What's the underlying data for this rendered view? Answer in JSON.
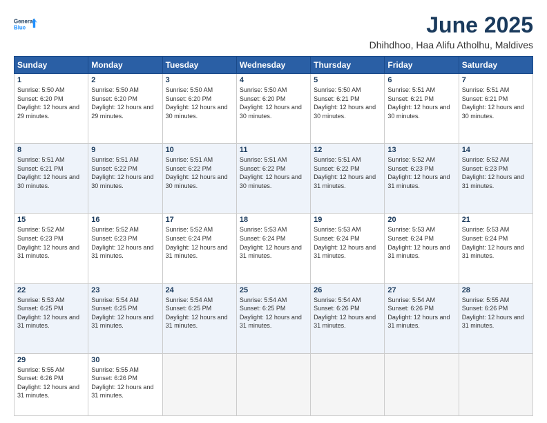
{
  "logo": {
    "line1": "General",
    "line2": "Blue"
  },
  "title": "June 2025",
  "location": "Dhihdhoo, Haa Alifu Atholhu, Maldives",
  "days_of_week": [
    "Sunday",
    "Monday",
    "Tuesday",
    "Wednesday",
    "Thursday",
    "Friday",
    "Saturday"
  ],
  "weeks": [
    [
      {
        "day": "1",
        "sunrise": "5:50 AM",
        "sunset": "6:20 PM",
        "daylight": "12 hours and 29 minutes."
      },
      {
        "day": "2",
        "sunrise": "5:50 AM",
        "sunset": "6:20 PM",
        "daylight": "12 hours and 29 minutes."
      },
      {
        "day": "3",
        "sunrise": "5:50 AM",
        "sunset": "6:20 PM",
        "daylight": "12 hours and 30 minutes."
      },
      {
        "day": "4",
        "sunrise": "5:50 AM",
        "sunset": "6:20 PM",
        "daylight": "12 hours and 30 minutes."
      },
      {
        "day": "5",
        "sunrise": "5:50 AM",
        "sunset": "6:21 PM",
        "daylight": "12 hours and 30 minutes."
      },
      {
        "day": "6",
        "sunrise": "5:51 AM",
        "sunset": "6:21 PM",
        "daylight": "12 hours and 30 minutes."
      },
      {
        "day": "7",
        "sunrise": "5:51 AM",
        "sunset": "6:21 PM",
        "daylight": "12 hours and 30 minutes."
      }
    ],
    [
      {
        "day": "8",
        "sunrise": "5:51 AM",
        "sunset": "6:21 PM",
        "daylight": "12 hours and 30 minutes."
      },
      {
        "day": "9",
        "sunrise": "5:51 AM",
        "sunset": "6:22 PM",
        "daylight": "12 hours and 30 minutes."
      },
      {
        "day": "10",
        "sunrise": "5:51 AM",
        "sunset": "6:22 PM",
        "daylight": "12 hours and 30 minutes."
      },
      {
        "day": "11",
        "sunrise": "5:51 AM",
        "sunset": "6:22 PM",
        "daylight": "12 hours and 30 minutes."
      },
      {
        "day": "12",
        "sunrise": "5:51 AM",
        "sunset": "6:22 PM",
        "daylight": "12 hours and 31 minutes."
      },
      {
        "day": "13",
        "sunrise": "5:52 AM",
        "sunset": "6:23 PM",
        "daylight": "12 hours and 31 minutes."
      },
      {
        "day": "14",
        "sunrise": "5:52 AM",
        "sunset": "6:23 PM",
        "daylight": "12 hours and 31 minutes."
      }
    ],
    [
      {
        "day": "15",
        "sunrise": "5:52 AM",
        "sunset": "6:23 PM",
        "daylight": "12 hours and 31 minutes."
      },
      {
        "day": "16",
        "sunrise": "5:52 AM",
        "sunset": "6:23 PM",
        "daylight": "12 hours and 31 minutes."
      },
      {
        "day": "17",
        "sunrise": "5:52 AM",
        "sunset": "6:24 PM",
        "daylight": "12 hours and 31 minutes."
      },
      {
        "day": "18",
        "sunrise": "5:53 AM",
        "sunset": "6:24 PM",
        "daylight": "12 hours and 31 minutes."
      },
      {
        "day": "19",
        "sunrise": "5:53 AM",
        "sunset": "6:24 PM",
        "daylight": "12 hours and 31 minutes."
      },
      {
        "day": "20",
        "sunrise": "5:53 AM",
        "sunset": "6:24 PM",
        "daylight": "12 hours and 31 minutes."
      },
      {
        "day": "21",
        "sunrise": "5:53 AM",
        "sunset": "6:24 PM",
        "daylight": "12 hours and 31 minutes."
      }
    ],
    [
      {
        "day": "22",
        "sunrise": "5:53 AM",
        "sunset": "6:25 PM",
        "daylight": "12 hours and 31 minutes."
      },
      {
        "day": "23",
        "sunrise": "5:54 AM",
        "sunset": "6:25 PM",
        "daylight": "12 hours and 31 minutes."
      },
      {
        "day": "24",
        "sunrise": "5:54 AM",
        "sunset": "6:25 PM",
        "daylight": "12 hours and 31 minutes."
      },
      {
        "day": "25",
        "sunrise": "5:54 AM",
        "sunset": "6:25 PM",
        "daylight": "12 hours and 31 minutes."
      },
      {
        "day": "26",
        "sunrise": "5:54 AM",
        "sunset": "6:26 PM",
        "daylight": "12 hours and 31 minutes."
      },
      {
        "day": "27",
        "sunrise": "5:54 AM",
        "sunset": "6:26 PM",
        "daylight": "12 hours and 31 minutes."
      },
      {
        "day": "28",
        "sunrise": "5:55 AM",
        "sunset": "6:26 PM",
        "daylight": "12 hours and 31 minutes."
      }
    ],
    [
      {
        "day": "29",
        "sunrise": "5:55 AM",
        "sunset": "6:26 PM",
        "daylight": "12 hours and 31 minutes."
      },
      {
        "day": "30",
        "sunrise": "5:55 AM",
        "sunset": "6:26 PM",
        "daylight": "12 hours and 31 minutes."
      },
      null,
      null,
      null,
      null,
      null
    ]
  ]
}
